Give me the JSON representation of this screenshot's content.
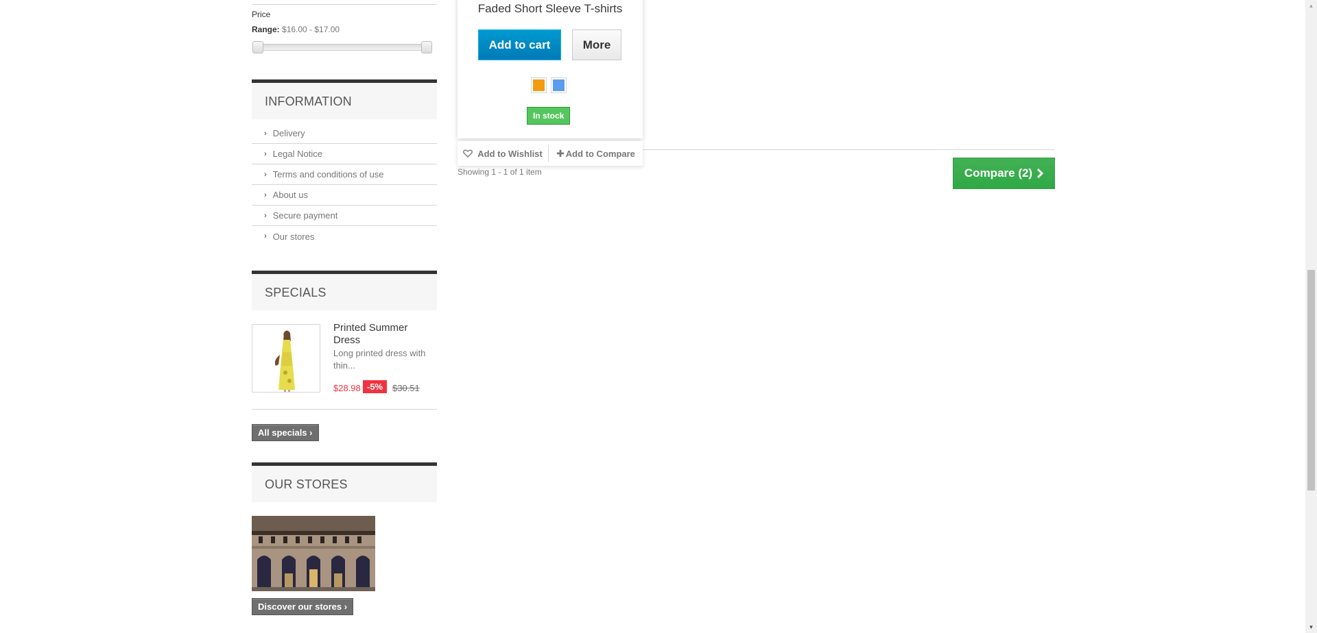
{
  "filters": {
    "price_label": "Price",
    "range_label": "Range:",
    "range_value": "$16.00 - $17.00"
  },
  "information": {
    "title": "INFORMATION",
    "items": [
      {
        "label": "Delivery"
      },
      {
        "label": "Legal Notice"
      },
      {
        "label": "Terms and conditions of use"
      },
      {
        "label": "About us"
      },
      {
        "label": "Secure payment"
      },
      {
        "label": "Our stores"
      }
    ]
  },
  "specials": {
    "title": "SPECIALS",
    "product_name": "Printed Summer Dress",
    "description": "Long printed dress with thin...",
    "price": "$28.98",
    "reduction": "-5%",
    "old_price": "$30.51",
    "all_button": "All specials"
  },
  "stores": {
    "title": "OUR STORES",
    "discover_button": "Discover our stores"
  },
  "product": {
    "name": "Faded Short Sleeve T-shirts",
    "add_to_cart": "Add to cart",
    "more": "More",
    "swatches": [
      {
        "color": "#f39c11"
      },
      {
        "color": "#5d9cec"
      }
    ],
    "availability": "In stock",
    "wishlist": "Add to Wishlist",
    "compare_add": "Add to Compare"
  },
  "listing": {
    "showing": "Showing 1 - 1 of 1 item",
    "compare_button": "Compare (2)"
  },
  "colors": {
    "accent_blue": "#0079b6",
    "stock_green": "#55c65e",
    "compare_green": "#3aa04c",
    "price_red": "#f13340"
  }
}
